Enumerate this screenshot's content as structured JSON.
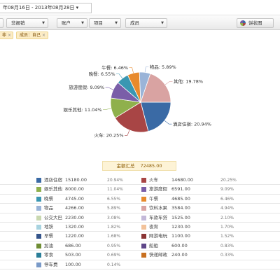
{
  "toolbar": {
    "date_range": "年08月16日 - 2013年08月28日",
    "date_arrow": "▾"
  },
  "filters": [
    {
      "label": "",
      "has_arrow": true
    },
    {
      "label": "非报销",
      "has_arrow": true
    },
    {
      "label": "账户",
      "has_arrow": true
    },
    {
      "label": "项目",
      "has_arrow": true
    },
    {
      "label": "成员",
      "has_arrow": true
    }
  ],
  "view_toggle": {
    "label": "饼状图",
    "icon": "pie-chart-icon"
  },
  "tags": [
    {
      "label": "非",
      "close": "×"
    },
    {
      "label": "成员：自己",
      "close": "×"
    }
  ],
  "summary": {
    "label": "金额汇总",
    "value": "72485.00"
  },
  "chart_data": {
    "type": "pie",
    "slices": [
      {
        "name": "酒店住宿",
        "value": 15180.0,
        "percent": 20.94,
        "label": "酒店住宿: 20.94%",
        "color": "#3a6aa5"
      },
      {
        "name": "火车",
        "value": 14680.0,
        "percent": 20.25,
        "label": "火车: 20.25%",
        "color": "#a84545"
      },
      {
        "name": "娱乐其他",
        "value": 8000.0,
        "percent": 11.04,
        "label": "娱乐其他: 11.04%",
        "color": "#8fb04c"
      },
      {
        "name": "旅游度假",
        "value": 6591.0,
        "percent": 9.09,
        "label": "旅游度假: 9.09%",
        "color": "#7a5ea8"
      },
      {
        "name": "晚餐",
        "value": 4745.0,
        "percent": 6.55,
        "label": "晚餐: 6.55%",
        "color": "#3a97b2"
      },
      {
        "name": "午餐",
        "value": 4685.0,
        "percent": 6.46,
        "label": "午餐: 6.46%",
        "color": "#e88a2c"
      },
      {
        "name": "物品",
        "value": 4266.0,
        "percent": 5.89,
        "label": "物品: 5.89%",
        "color": "#9ab4d8"
      },
      {
        "name": "其他",
        "value": 14338.0,
        "percent": 19.78,
        "label": "其他: 19.78%",
        "color": "#d9a3a2"
      }
    ]
  },
  "legend_rows": [
    {
      "left": {
        "name": "酒店住宿",
        "value": "15180.00",
        "pct": "20.94%",
        "color": "#3a6aa5"
      },
      "right": {
        "name": "火车",
        "value": "14680.00",
        "pct": "20.25%",
        "color": "#a84545"
      }
    },
    {
      "left": {
        "name": "娱乐其他",
        "value": "8000.00",
        "pct": "11.04%",
        "color": "#8fb04c"
      },
      "right": {
        "name": "旅游度假",
        "value": "6591.00",
        "pct": "9.09%",
        "color": "#7a5ea8"
      }
    },
    {
      "left": {
        "name": "晚餐",
        "value": "4745.00",
        "pct": "6.55%",
        "color": "#3a97b2"
      },
      "right": {
        "name": "午餐",
        "value": "4685.00",
        "pct": "6.46%",
        "color": "#e88a2c"
      }
    },
    {
      "left": {
        "name": "物品",
        "value": "4266.00",
        "pct": "5.89%",
        "color": "#9ab4d8"
      },
      "right": {
        "name": "饮料水果",
        "value": "3584.00",
        "pct": "4.94%",
        "color": "#d9a3a2"
      }
    },
    {
      "left": {
        "name": "公交大巴",
        "value": "2230.00",
        "pct": "3.08%",
        "color": "#c9d8b0"
      },
      "right": {
        "name": "车款车贷",
        "value": "1525.00",
        "pct": "2.10%",
        "color": "#c3b8d8"
      }
    },
    {
      "left": {
        "name": "地铁",
        "value": "1320.00",
        "pct": "1.82%",
        "color": "#a8d3e0"
      },
      "right": {
        "name": "夜宵",
        "value": "1230.00",
        "pct": "1.70%",
        "color": "#f2c29a"
      }
    },
    {
      "left": {
        "name": "早餐",
        "value": "1220.00",
        "pct": "1.68%",
        "color": "#34548a"
      },
      "right": {
        "name": "网游电玩",
        "value": "1100.00",
        "pct": "1.52%",
        "color": "#8a3434"
      }
    },
    {
      "left": {
        "name": "加油",
        "value": "686.00",
        "pct": "0.95%",
        "color": "#6f8d34"
      },
      "right": {
        "name": "船舶",
        "value": "600.00",
        "pct": "0.83%",
        "color": "#5e4688"
      }
    },
    {
      "left": {
        "name": "零食",
        "value": "503.00",
        "pct": "0.69%",
        "color": "#2a7e98"
      },
      "right": {
        "name": "快递邮政",
        "value": "240.00",
        "pct": "0.33%",
        "color": "#c87020"
      }
    },
    {
      "left": {
        "name": "停车费",
        "value": "100.00",
        "pct": "0.14%",
        "color": "#7a9ac8"
      },
      "right": null
    }
  ]
}
